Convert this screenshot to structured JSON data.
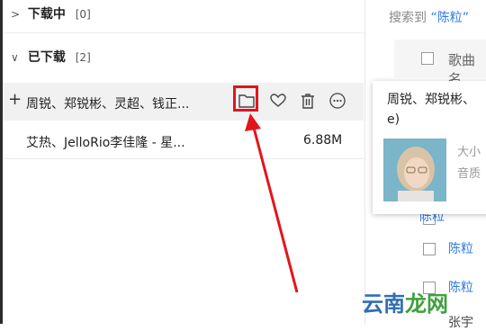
{
  "left": {
    "downloading": {
      "label": "下载中",
      "count": "[0]"
    },
    "downloaded": {
      "label": "已下载",
      "count": "[2]"
    },
    "items": [
      {
        "name": "周锐、郑锐彬、灵超、钱正...",
        "size": ""
      },
      {
        "name": "艾热、JelloRio李佳隆 - 星...",
        "size": "6.88M"
      }
    ]
  },
  "right": {
    "search_prefix": "搜索到",
    "search_keyword": "“陈粒”",
    "column_song": "歌曲名",
    "popup": {
      "title_line1": "周锐、郑锐彬、",
      "title_line2": "e)",
      "size_label": "大小",
      "quality_label": "音质"
    },
    "rows": [
      "陈粒",
      "陈粒",
      "陈粒",
      "张宇"
    ]
  },
  "watermark": {
    "part1": "云南",
    "part2": "龙网"
  },
  "colors": {
    "accent": "#2f7ce0",
    "annotation": "#e2151d"
  }
}
